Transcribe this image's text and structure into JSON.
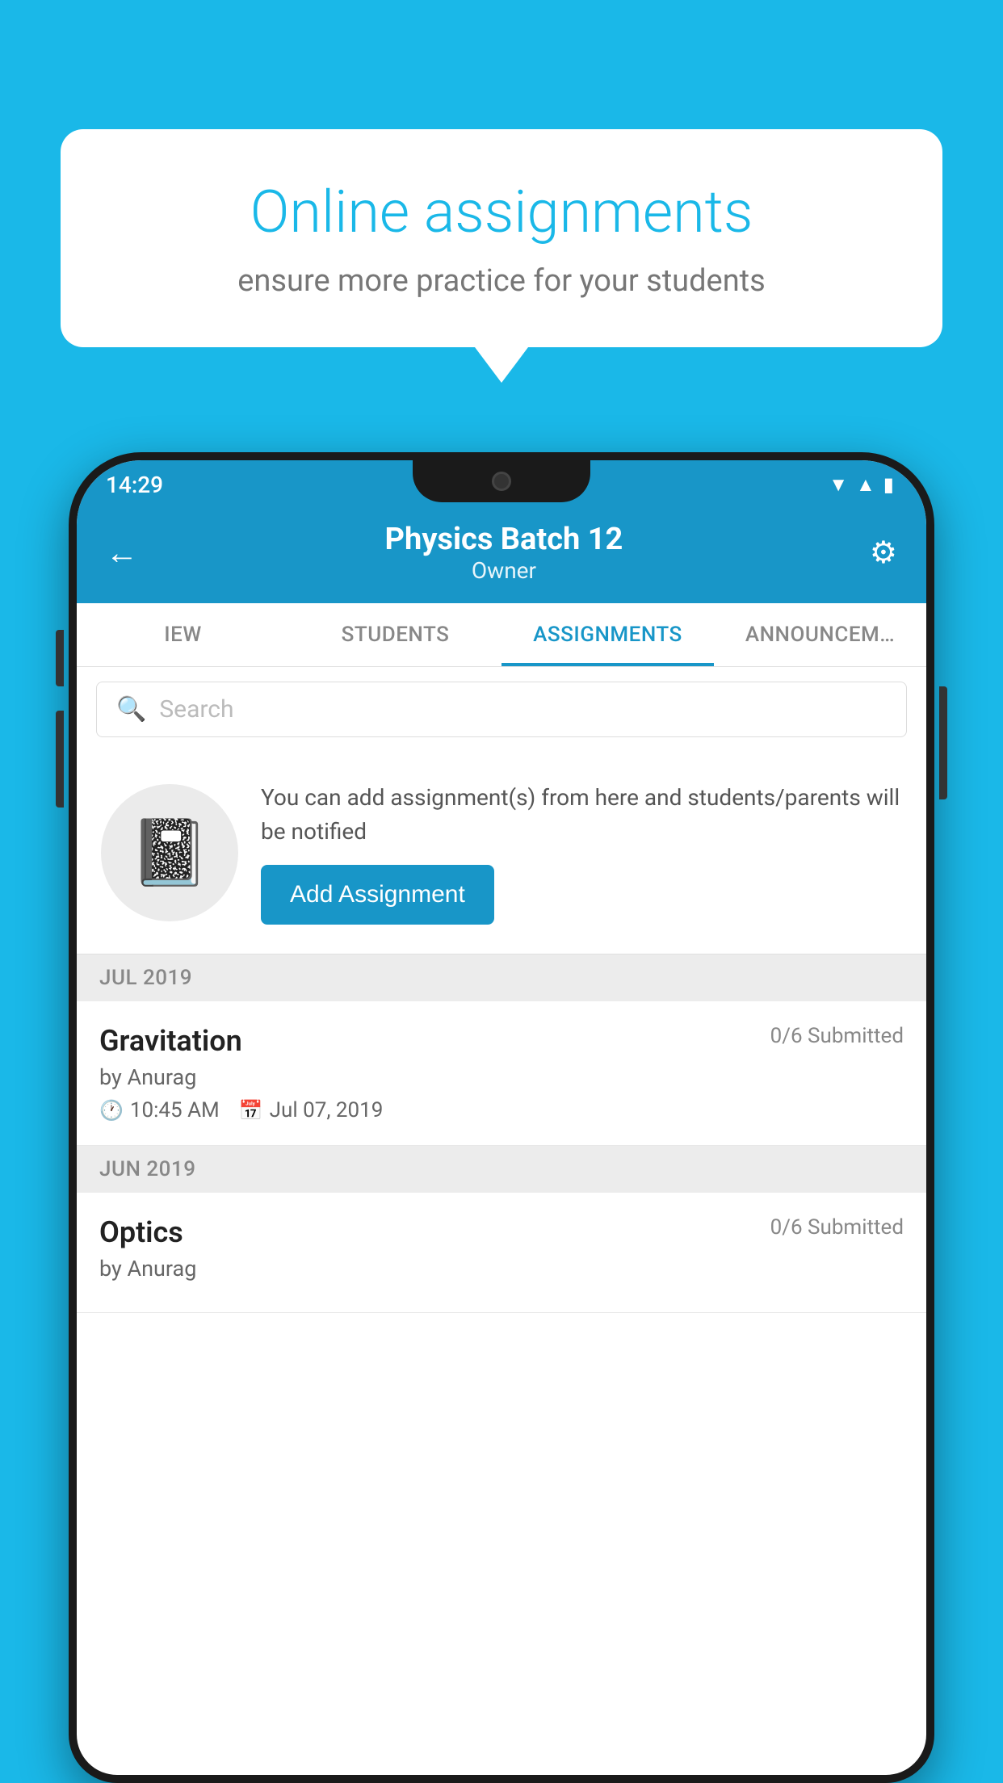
{
  "background_color": "#1ab8e8",
  "speech_bubble": {
    "title": "Online assignments",
    "subtitle": "ensure more practice for your students"
  },
  "status_bar": {
    "time": "14:29",
    "icons": [
      "wifi",
      "signal",
      "battery"
    ]
  },
  "header": {
    "title": "Physics Batch 12",
    "subtitle": "Owner",
    "back_label": "←",
    "settings_label": "⚙"
  },
  "tabs": [
    {
      "label": "IEW",
      "active": false
    },
    {
      "label": "STUDENTS",
      "active": false
    },
    {
      "label": "ASSIGNMENTS",
      "active": true
    },
    {
      "label": "ANNOUNCEM…",
      "active": false
    }
  ],
  "search": {
    "placeholder": "Search"
  },
  "empty_state": {
    "description": "You can add assignment(s) from here and students/parents will be notified",
    "button_label": "Add Assignment"
  },
  "sections": [
    {
      "month": "JUL 2019",
      "assignments": [
        {
          "name": "Gravitation",
          "submitted": "0/6 Submitted",
          "by": "by Anurag",
          "time": "10:45 AM",
          "date": "Jul 07, 2019"
        }
      ]
    },
    {
      "month": "JUN 2019",
      "assignments": [
        {
          "name": "Optics",
          "submitted": "0/6 Submitted",
          "by": "by Anurag",
          "time": "",
          "date": ""
        }
      ]
    }
  ]
}
